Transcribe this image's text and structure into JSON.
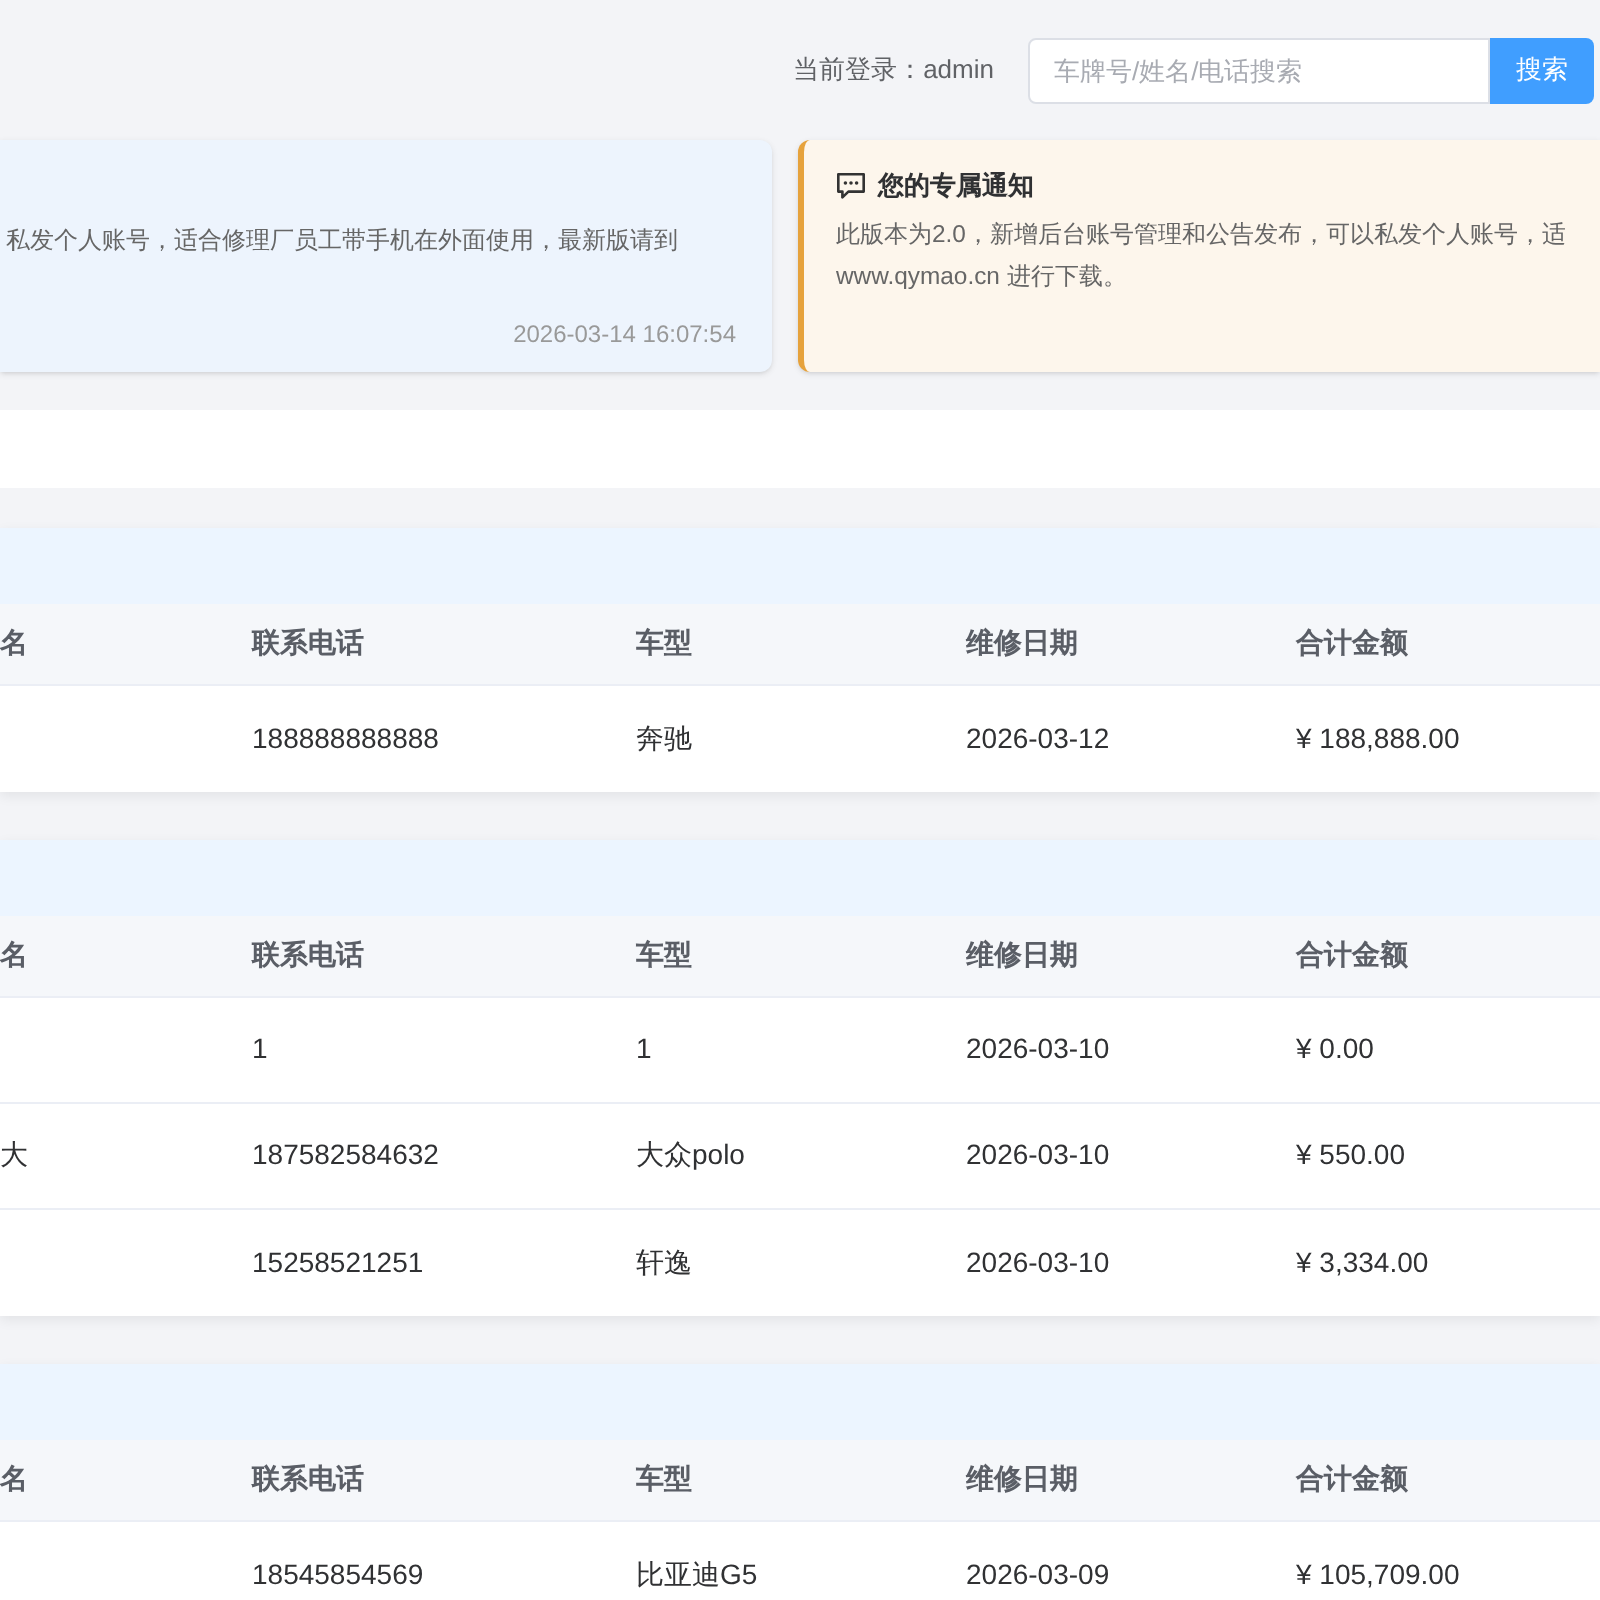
{
  "header": {
    "login_label": "当前登录：admin",
    "search": {
      "placeholder": "车牌号/姓名/电话搜索"
    },
    "search_button": "搜索"
  },
  "notices": [
    {
      "kind": "info",
      "lines": [
        "私发个人账号，适合修理厂员工带手机在外面使用，最新版请到"
      ],
      "time": "2026-03-14 16:07:54"
    },
    {
      "kind": "warning",
      "title": "您的专属通知",
      "lines": [
        "此版本为2.0，新增后台账号管理和公告发布，可以私发个人账号，适",
        "www.qymao.cn 进行下载。"
      ]
    }
  ],
  "sections": [
    {
      "columns": [
        "名",
        "联系电话",
        "车型",
        "维修日期",
        "合计金额"
      ],
      "rows": [
        {
          "phone": "188888888888",
          "car_model": "奔驰",
          "repair_date": "2026-03-12",
          "total": "¥ 188,888.00"
        }
      ]
    },
    {
      "columns": [
        "名",
        "联系电话",
        "车型",
        "维修日期",
        "合计金额"
      ],
      "rows": [
        {
          "phone": "1",
          "car_model": "1",
          "repair_date": "2026-03-10",
          "total": "¥ 0.00"
        },
        {
          "column_1": "大",
          "phone": "187582584632",
          "car_model": "大众polo",
          "repair_date": "2026-03-10",
          "total": "¥ 550.00"
        },
        {
          "phone": "15258521251",
          "car_model": "轩逸",
          "repair_date": "2026-03-10",
          "total": "¥ 3,334.00"
        }
      ]
    },
    {
      "columns": [
        "名",
        "联系电话",
        "车型",
        "维修日期",
        "合计金额"
      ],
      "rows": [
        {
          "phone": "18545854569",
          "car_model": "比亚迪G5",
          "repair_date": "2026-03-09",
          "total": "¥ 105,709.00"
        }
      ]
    }
  ]
}
